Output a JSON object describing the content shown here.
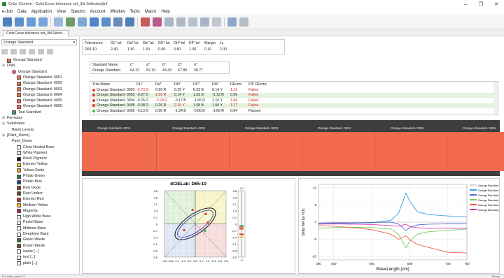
{
  "window": {
    "title": "Color iControl - ColorCurve tolerance set_3ld Selected.jb3",
    "min": "–",
    "max": "❐",
    "close": "✕"
  },
  "menu": [
    "e-Job",
    "Data",
    "Application",
    "View",
    "Spectro",
    "Account",
    "Window",
    "Tools",
    "Macro",
    "Help"
  ],
  "doc_tab": "ColorCurve tolerance set_3ld Select...",
  "left": {
    "standard_select": "Orange Standard",
    "tree": [
      {
        "label": "Orange Standard",
        "color": "#f26b51",
        "indent": 0,
        "kind": "swatch"
      },
      {
        "label": "Data",
        "indent": 0,
        "kind": "folder"
      },
      {
        "label": "Orange Standard",
        "indent": 1,
        "kind": "circle"
      },
      {
        "label": "Orange Standard- 0001",
        "color": "#f26b51",
        "indent": 2,
        "kind": "trial"
      },
      {
        "label": "Orange Standard- 0002",
        "color": "#f26b51",
        "indent": 2,
        "kind": "trial"
      },
      {
        "label": "Orange Standard- 0003",
        "color": "#f26b51",
        "indent": 2,
        "kind": "trial"
      },
      {
        "label": "Orange Standard- 0004",
        "color": "#f26b51",
        "indent": 2,
        "kind": "trial"
      },
      {
        "label": "Orange Standard- 0005",
        "color": "#f26b51",
        "indent": 2,
        "kind": "trial"
      },
      {
        "label": "Orange Standard- 0006",
        "color": "#f26b51",
        "indent": 2,
        "kind": "trial"
      },
      {
        "label": "Teal Standard",
        "color": "#3a8f8a",
        "indent": 1,
        "kind": "swatch"
      },
      {
        "label": "Formulas",
        "indent": 0,
        "kind": "folder"
      },
      {
        "label": "Substrates",
        "indent": 0,
        "kind": "folder"
      },
      {
        "label": "Blank Leneta",
        "indent": 1,
        "kind": "sub"
      },
      {
        "label": "[Paint_Demo]",
        "indent": 0,
        "kind": "folder"
      },
      {
        "label": "Paint_Demo",
        "indent": 1,
        "kind": "sub"
      },
      {
        "label": "Clear Neutral Base",
        "color": "#ffffff",
        "indent": 2,
        "kind": "pig"
      },
      {
        "label": "White Pigment",
        "color": "#ffffff",
        "indent": 2,
        "kind": "pig"
      },
      {
        "label": "Black Pigment",
        "color": "#111111",
        "indent": 2,
        "kind": "pig"
      },
      {
        "label": "Exterior Yellow",
        "color": "#f2d21a",
        "indent": 2,
        "kind": "pig"
      },
      {
        "label": "Yellow Oxide",
        "color": "#d9a521",
        "indent": 2,
        "kind": "pig"
      },
      {
        "label": "Phtalo Green",
        "color": "#1e7a4a",
        "indent": 2,
        "kind": "pig"
      },
      {
        "label": "Phtalo Blue",
        "color": "#1f3f8f",
        "indent": 2,
        "kind": "pig"
      },
      {
        "label": "Red Oxide",
        "color": "#9a3a24",
        "indent": 2,
        "kind": "pig"
      },
      {
        "label": "Raw Umber",
        "color": "#5a4632",
        "indent": 2,
        "kind": "pig"
      },
      {
        "label": "Exterior Red",
        "color": "#d02a22",
        "indent": 2,
        "kind": "pig"
      },
      {
        "label": "Medium Yellow",
        "color": "#f5c41c",
        "indent": 2,
        "kind": "pig"
      },
      {
        "label": "Magenta",
        "color": "#b02070",
        "indent": 2,
        "kind": "pig"
      },
      {
        "label": "High White Base",
        "color": "#ffffff",
        "indent": 2,
        "kind": "pig"
      },
      {
        "label": "Pastel Base",
        "color": "#ffffff",
        "indent": 2,
        "kind": "pig"
      },
      {
        "label": "Midtone Base",
        "color": "#ffffff",
        "indent": 2,
        "kind": "pig"
      },
      {
        "label": "Deeptone Base",
        "color": "#ffffff",
        "indent": 2,
        "kind": "pig"
      },
      {
        "label": "Green Waste",
        "color": "#2f6f3a",
        "indent": 2,
        "kind": "pig"
      },
      {
        "label": "Brown Waste",
        "color": "#6b4a30",
        "indent": 2,
        "kind": "pig"
      },
      {
        "label": "waste [...]",
        "color": "#ffffff",
        "indent": 2,
        "kind": "pig"
      },
      {
        "label": "test [...]",
        "color": "#ffffff",
        "indent": 2,
        "kind": "pig"
      },
      {
        "label": "plain [...]",
        "color": "#ffffff",
        "indent": 2,
        "kind": "pig"
      }
    ]
  },
  "tolerances": {
    "headers": [
      "Tolerances:",
      "DL* tol",
      "Da* tol",
      "Db* tol",
      "DC* tol",
      "DH* tol",
      "P/F tol",
      "Margin",
      "l:s"
    ],
    "values": [
      "D65-10",
      "2.40",
      "1.50",
      "1.50",
      "0.08",
      "0.80",
      "1.00",
      "0.10",
      "2.00"
    ]
  },
  "standard": {
    "headers": [
      "Standard Name",
      "L*",
      "a*",
      "b*",
      "C*",
      "h°"
    ],
    "values": [
      "Orange Standard",
      "64.22",
      "52.19",
      "43.43",
      "67.89",
      "39.77"
    ]
  },
  "trials": {
    "headers": [
      "Trial Name",
      "DL*",
      "Da*",
      "Db*",
      "DC*",
      "DH*",
      "DEcmc",
      "P/F DEcmc"
    ],
    "rows": [
      {
        "name": "Orange Standard- 0002",
        "dot": "#e0392a",
        "cells": [
          "-2.73 D",
          "0.99 R",
          "0.25 Y",
          "0.23 B",
          "0.14 Y",
          "1.11",
          "Failed"
        ],
        "red": [
          true,
          false,
          false,
          false,
          false,
          true,
          true
        ]
      },
      {
        "name": "Orange Standard- 0003",
        "dot": "#e0392a",
        "cells": [
          "-0.07 D",
          "1.95 R",
          "0.14 Y",
          "1.63 B",
          "-1.12 R",
          "0.99",
          "Failed"
        ],
        "red": [
          false,
          true,
          false,
          false,
          false,
          false,
          true
        ]
      },
      {
        "name": "Orange Standard- 0004",
        "dot": "#e0392a",
        "cells": [
          "-0.25 D",
          "-2.03 G",
          "-0.17 B",
          "-1.66 D",
          "1.16 Y",
          "1.84",
          "Failed"
        ],
        "red": [
          false,
          true,
          false,
          false,
          false,
          true,
          true
        ]
      },
      {
        "name": "Orange Standard- 0005",
        "dot": "#e0392a",
        "cells": [
          "-0.08 D",
          "0.26 R",
          "2.26 Y",
          "1.68 B",
          "1.56 Y",
          "1.27",
          "Failed"
        ],
        "red": [
          false,
          false,
          true,
          false,
          false,
          true,
          true
        ]
      },
      {
        "name": "Orange Standard- 0006",
        "dot": "#2fb34a",
        "cells": [
          "-0.13 D",
          "0.96 R",
          "-1.34 B",
          "-0.80 D",
          "-1.66 R",
          "0.84",
          "Passed"
        ],
        "red": [
          false,
          false,
          false,
          false,
          false,
          false,
          false
        ]
      }
    ]
  },
  "swatches": {
    "labels": [
      "Orange Standard- 0001",
      "Orange Standard- 0002",
      "Orange Standard- 0003",
      "Orange Standard- 0004",
      "Orange Standard- 0005",
      "Orange Standard- 0006"
    ],
    "color": "#f26b51"
  },
  "dcielab": {
    "title": "dCIELab: D65-10",
    "left_ticks": [
      "3.5",
      "2.8",
      "2.1",
      "1.4",
      "0.7",
      "0",
      "-0.7",
      "-1.4",
      "-2.1",
      "-2.8",
      "-3.5"
    ],
    "bottom_ticks": [
      "-3.5",
      "-2.8",
      "-2.1",
      "-1.4",
      "-0.7",
      "0.0",
      "0.7",
      "1.4",
      "2.1",
      "2.8",
      "3.5"
    ],
    "right_ticks": [
      "3.5",
      "2.8",
      "2.1",
      "1.4",
      "0.7",
      "0",
      "-0.7",
      "-1.4",
      "-2.1",
      "-2.8",
      "-3.5"
    ],
    "top_label": "+L*",
    "bottom_label": "-L*"
  },
  "chart_data": {
    "type": "line",
    "ylabel": "Delta %R (or %T)",
    "xlabel": "WaveLength (nm)",
    "x_ticks": [
      360,
      400,
      500,
      600,
      700,
      750
    ],
    "y_ticks": [
      10,
      5,
      0,
      -5,
      -10
    ],
    "xlim": [
      360,
      750
    ],
    "ylim": [
      -11,
      11
    ],
    "x": [
      360,
      400,
      450,
      500,
      550,
      570,
      590,
      600,
      620,
      650,
      700,
      750
    ],
    "series": [
      {
        "name": "Orange Standard",
        "color": "#d6d6d6",
        "values": [
          0,
          0,
          0,
          0,
          0,
          0,
          0,
          0,
          0,
          0,
          0,
          0
        ]
      },
      {
        "name": "Orange Standard- 0002",
        "color": "#3aa0e0",
        "values": [
          -0.5,
          -0.4,
          -0.3,
          -0.2,
          0.5,
          2.5,
          8.5,
          6.0,
          3.0,
          2.2,
          1.8,
          1.5
        ]
      },
      {
        "name": "Orange Standard- 0003",
        "color": "#5a6ad0",
        "values": [
          -0.3,
          -0.2,
          -0.2,
          -0.1,
          0.0,
          -0.5,
          -2.5,
          -1.5,
          -0.8,
          -0.6,
          -0.5,
          -0.5
        ]
      },
      {
        "name": "Orange Standard- 0004",
        "color": "#70d060",
        "values": [
          -1.8,
          -1.6,
          -1.5,
          -1.6,
          -2.0,
          -3.5,
          -7.5,
          -5.5,
          -3.5,
          -2.8,
          -2.4,
          -2.0
        ]
      },
      {
        "name": "Orange Standard- 0005",
        "color": "#f2604a",
        "values": [
          -1.0,
          -1.2,
          -1.6,
          -2.2,
          -3.5,
          -5.0,
          -4.0,
          -5.2,
          -6.5,
          -7.4,
          -8.8,
          -9.0
        ]
      },
      {
        "name": "Orange Standard- 0006",
        "color": "#e03ab0",
        "values": [
          -0.6,
          -0.5,
          -0.6,
          -0.7,
          -1.0,
          -1.2,
          -0.6,
          -1.3,
          -1.6,
          -1.8,
          -1.8,
          -1.8
        ]
      }
    ]
  },
  "status": {
    "left": "For Help, press F1",
    "right": "Ready"
  }
}
